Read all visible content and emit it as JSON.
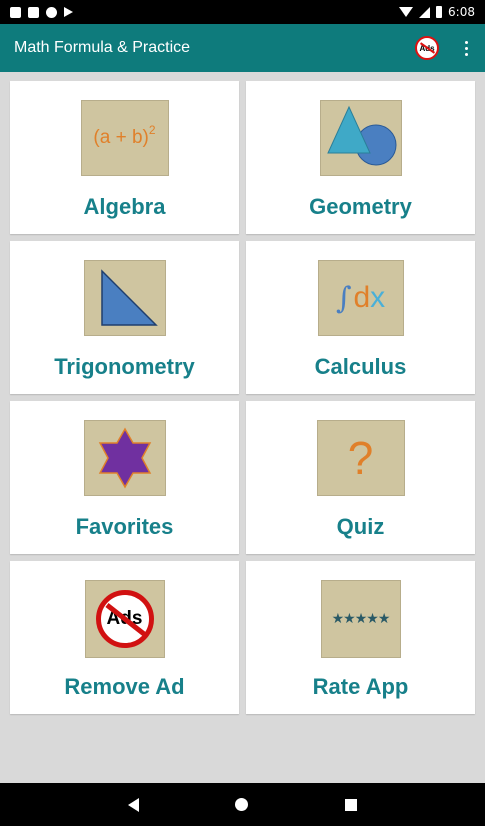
{
  "status_bar": {
    "time": "6:08",
    "left_icons": [
      "a-icon",
      "sd-card-icon",
      "circle-icon",
      "play-store-icon"
    ],
    "right_icons": [
      "wifi-icon",
      "signal-icon",
      "battery-icon"
    ]
  },
  "app_bar": {
    "title": "Math Formula & Practice",
    "ads_badge_text": "Ads",
    "actions": [
      "remove-ads-icon",
      "more-vert-icon"
    ]
  },
  "tiles": [
    {
      "label": "Algebra",
      "icon": "algebra-icon",
      "formula_text": "(a + b)",
      "exponent": "2"
    },
    {
      "label": "Geometry",
      "icon": "geometry-icon"
    },
    {
      "label": "Trigonometry",
      "icon": "trigonometry-icon"
    },
    {
      "label": "Calculus",
      "icon": "calculus-icon",
      "integral_text": "∫",
      "dx_d": "d",
      "dx_x": "x"
    },
    {
      "label": "Favorites",
      "icon": "star-icon"
    },
    {
      "label": "Quiz",
      "icon": "question-icon",
      "symbol": "?"
    },
    {
      "label": "Remove Ad",
      "icon": "no-ads-icon",
      "ads_text": "Ads"
    },
    {
      "label": "Rate App",
      "icon": "five-stars-icon",
      "stars": "★★★★★"
    }
  ],
  "colors": {
    "app_bar": "#0e7b7c",
    "label": "#17808a",
    "icon_bg": "#cfc5a0",
    "orange": "#e0802a",
    "blue_shape": "#4a7fc1",
    "purple_star": "#7030a0",
    "red_ring": "#d11111"
  },
  "nav_bar": {
    "buttons": [
      "back-icon",
      "home-icon",
      "recents-icon"
    ]
  }
}
